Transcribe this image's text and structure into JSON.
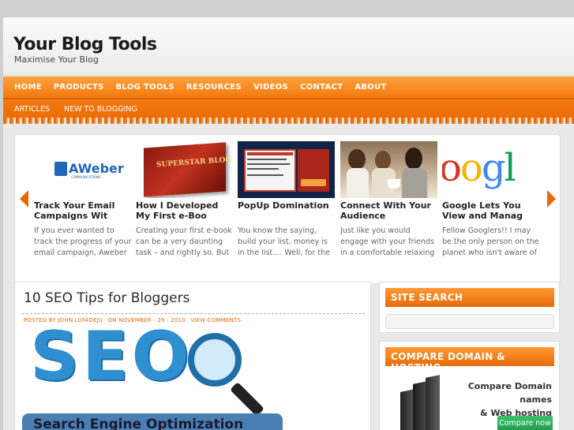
{
  "site": {
    "title": "Your Blog Tools",
    "tagline": "Maximise Your Blog"
  },
  "nav": {
    "primary": [
      "HOME",
      "PRODUCTS",
      "BLOG TOOLS",
      "RESOURCES",
      "VIDEOS",
      "CONTACT",
      "ABOUT"
    ],
    "secondary": [
      "ARTICLES",
      "NEW TO BLOGGING"
    ]
  },
  "slider": {
    "slides": [
      {
        "title": "Track Your Email Campaigns Wit",
        "excerpt": "If you ever wanted to track the progress of your email campaign, Aweber has a ...",
        "thumb": "AWeber",
        "thumb_sub": "COMMUNICATIONS"
      },
      {
        "title": "How I Developed My First e-Boo",
        "excerpt": "Creating your first e-book can be a very daunting task – and rightly so. But",
        "thumb": "SUPERSTAR BLOG"
      },
      {
        "title": "PopUp Domination",
        "excerpt": "You know the saying, build your list, money is in the list.... Well, for the past ...",
        "thumb": "popup-screenshot"
      },
      {
        "title": "Connect With Your Audience",
        "excerpt": "Just like you would engage with your friends in a comfortable relaxing mode",
        "thumb": "friends-photo"
      },
      {
        "title": "Google Lets You View and Manag",
        "excerpt": "Fellow Googlers!! I may be the only person on the planet who isn't aware of",
        "thumb": "oogl"
      }
    ]
  },
  "post": {
    "title": "10 SEO Tips for Bloggers",
    "author": "POSTED BY JOHN LUFADEJU",
    "date": "ON NOVEMBER - 29 - 2010",
    "comments": "VIEW COMMENTS",
    "image_text": "SEO",
    "image_caption": "Search Engine Optimization"
  },
  "sidebar": {
    "search_title": "SITE SEARCH",
    "compare_title": "COMPARE DOMAIN & HOSTING",
    "compare_text_1": "Compare Domain names",
    "compare_text_2": "& Web hosting prices",
    "compare_button": "Compare now"
  },
  "colors": {
    "accent": "#e86a06",
    "nav_top": "#ffa23c",
    "button_green": "#1f9a4a"
  }
}
